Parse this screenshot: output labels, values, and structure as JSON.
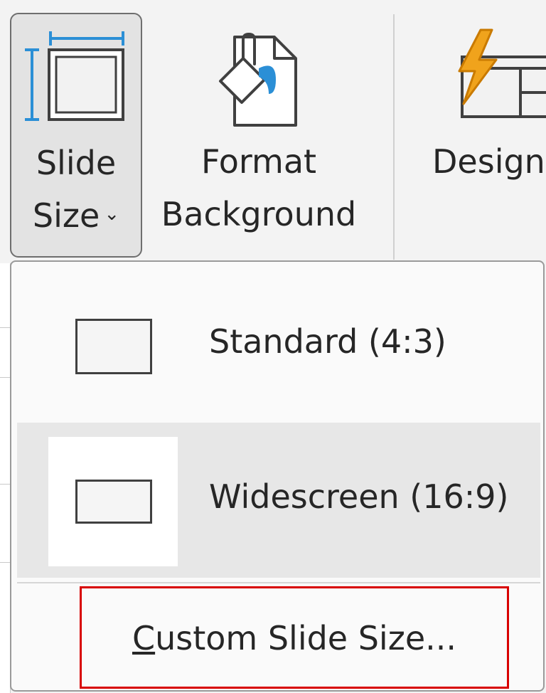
{
  "ribbon": {
    "slide_size": {
      "line1": "Slide",
      "line2": "Size",
      "chevron": "⌄",
      "icon": "slide-size-icon"
    },
    "format_background": {
      "line1": "Format",
      "line2": "Background",
      "icon": "format-background-icon"
    },
    "designer": {
      "line1": "Design",
      "icon": "designer-icon"
    }
  },
  "dropdown": {
    "items": [
      {
        "label": "Standard (4:3)",
        "icon": "standard-slide-icon",
        "hovered": false
      },
      {
        "label": "Widescreen (16:9)",
        "icon": "widescreen-slide-icon",
        "hovered": true
      }
    ],
    "custom": {
      "accel": "C",
      "rest": "ustom Slide Size..."
    }
  },
  "colors": {
    "accent_blue": "#2b8fd6",
    "highlight_red": "#d80000",
    "lightning_orange": "#f0a31c"
  }
}
